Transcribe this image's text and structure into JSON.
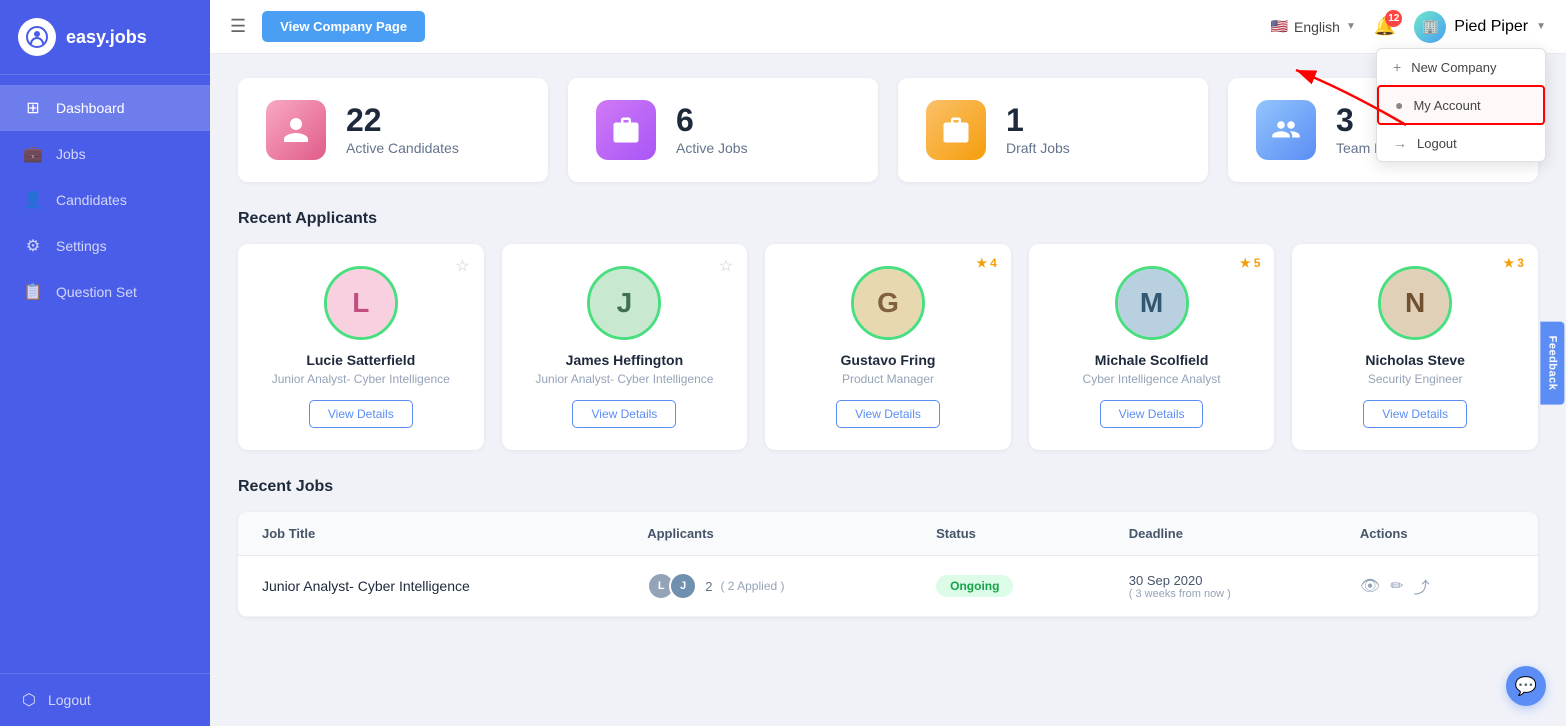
{
  "app": {
    "name": "easy.jobs",
    "logo_text": "iq"
  },
  "sidebar": {
    "items": [
      {
        "id": "dashboard",
        "label": "Dashboard",
        "icon": "⊞",
        "active": true
      },
      {
        "id": "jobs",
        "label": "Jobs",
        "icon": "💼",
        "active": false
      },
      {
        "id": "candidates",
        "label": "Candidates",
        "icon": "👤",
        "active": false
      },
      {
        "id": "settings",
        "label": "Settings",
        "icon": "⚙",
        "active": false
      },
      {
        "id": "question-set",
        "label": "Question Set",
        "icon": "📋",
        "active": false
      }
    ],
    "logout_label": "Logout"
  },
  "topbar": {
    "view_company_btn": "View Company Page",
    "language": "English",
    "company": "Pied Piper",
    "notif_count": "12"
  },
  "dropdown": {
    "items": [
      {
        "id": "new-company",
        "label": "New Company",
        "icon": "+"
      },
      {
        "id": "my-account",
        "label": "My Account",
        "icon": "○",
        "highlighted": true
      },
      {
        "id": "logout",
        "label": "Logout",
        "icon": "→"
      }
    ]
  },
  "stats": [
    {
      "id": "candidates",
      "num": "22",
      "label": "Active Candidates",
      "color": "pink",
      "icon": "👤"
    },
    {
      "id": "active-jobs",
      "num": "6",
      "label": "Active Jobs",
      "color": "purple",
      "icon": "💼"
    },
    {
      "id": "draft-jobs",
      "num": "1",
      "label": "Draft Jobs",
      "color": "orange",
      "icon": "💼"
    },
    {
      "id": "team",
      "num": "3",
      "label": "Team Members",
      "color": "blue",
      "icon": "👥"
    }
  ],
  "recent_applicants": {
    "title": "Recent Applicants",
    "cards": [
      {
        "id": 1,
        "name": "Lucie Satterfield",
        "role": "Junior Analyst- Cyber Intelligence",
        "starred": false,
        "rating": null,
        "avatar_bg": "#e8b4c0",
        "avatar_letter": "L",
        "avatar_color": "#c05080"
      },
      {
        "id": 2,
        "name": "James Heffington",
        "role": "Junior Analyst- Cyber Intelligence",
        "starred": false,
        "rating": null,
        "avatar_bg": "#b8d4c0",
        "avatar_letter": "J",
        "avatar_color": "#407050"
      },
      {
        "id": 3,
        "name": "Gustavo Fring",
        "role": "Product Manager",
        "starred": true,
        "rating": "4",
        "avatar_bg": "#d4c8a0",
        "avatar_letter": "G",
        "avatar_color": "#806040"
      },
      {
        "id": 4,
        "name": "Michale Scolfield",
        "role": "Cyber Intelligence Analyst",
        "starred": true,
        "rating": "5",
        "avatar_bg": "#b0c8d8",
        "avatar_letter": "M",
        "avatar_color": "#305870"
      },
      {
        "id": 5,
        "name": "Nicholas Steve",
        "role": "Security Engineer",
        "starred": true,
        "rating": "3",
        "avatar_bg": "#d4c0a0",
        "avatar_letter": "N",
        "avatar_color": "#705030"
      }
    ],
    "view_btn_label": "View Details"
  },
  "recent_jobs": {
    "title": "Recent Jobs",
    "columns": [
      "Job Title",
      "Applicants",
      "Status",
      "Deadline",
      "Actions"
    ],
    "rows": [
      {
        "title": "Junior Analyst- Cyber Intelligence",
        "applicant_count": "2",
        "applied_text": "( 2 Applied )",
        "status": "Ongoing",
        "status_class": "ongoing",
        "deadline": "30 Sep 2020",
        "deadline_sub": "( 3 weeks from now )"
      }
    ]
  },
  "feedback_tab": "Feedback",
  "chat_icon": "💬"
}
